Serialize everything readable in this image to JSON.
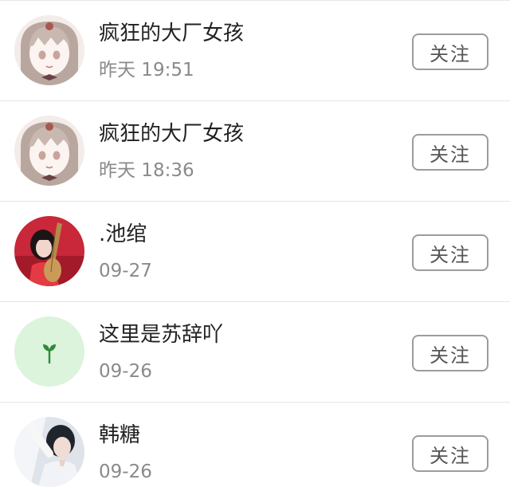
{
  "follow_list": [
    {
      "name": "疯狂的大厂女孩",
      "time": "昨天 19:51",
      "follow_label": "关注",
      "avatar_icon": "anime-girl-avatar-icon"
    },
    {
      "name": "疯狂的大厂女孩",
      "time": "昨天 18:36",
      "follow_label": "关注",
      "avatar_icon": "anime-girl-avatar-icon"
    },
    {
      "name": ".池绾",
      "time": "09-27",
      "follow_label": "关注",
      "avatar_icon": "pipa-player-avatar-icon"
    },
    {
      "name": "这里是苏辞吖",
      "time": "09-26",
      "follow_label": "关注",
      "avatar_icon": "sprout-avatar-icon"
    },
    {
      "name": "韩糖",
      "time": "09-26",
      "follow_label": "关注",
      "avatar_icon": "portrait-avatar-icon"
    }
  ],
  "colors": {
    "name_text": "#222222",
    "time_text": "#8a8a8a",
    "button_border": "#9c9c9c",
    "sprout_bg": "#dcf3dc",
    "sprout_green": "#2f8a3a"
  }
}
